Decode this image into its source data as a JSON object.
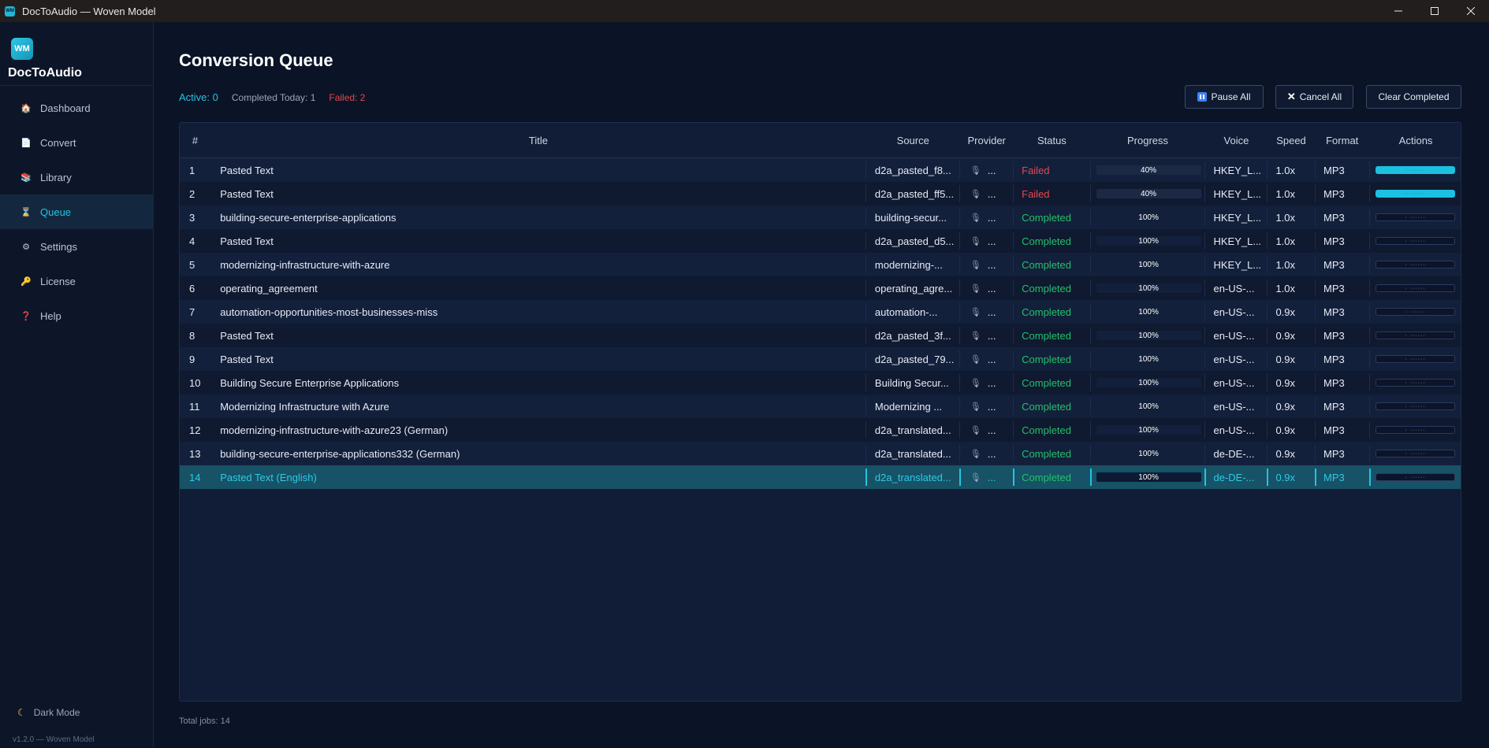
{
  "window": {
    "title": "DocToAudio — Woven Model",
    "icon_text": "WM",
    "controls": [
      "minimize-icon",
      "maximize-icon",
      "close-icon"
    ]
  },
  "sidebar": {
    "logo_text": "WM",
    "app_name": "DocToAudio",
    "items": [
      {
        "label": "Dashboard",
        "icon": "home-icon",
        "glyph": "🏠"
      },
      {
        "label": "Convert",
        "icon": "document-icon",
        "glyph": "📄"
      },
      {
        "label": "Library",
        "icon": "books-icon",
        "glyph": "📚"
      },
      {
        "label": "Queue",
        "icon": "hourglass-icon",
        "glyph": "⌛",
        "active": true
      },
      {
        "label": "Settings",
        "icon": "gear-icon",
        "glyph": "⚙"
      },
      {
        "label": "License",
        "icon": "key-icon",
        "glyph": "🔑"
      },
      {
        "label": "Help",
        "icon": "question-icon",
        "glyph": "❓"
      }
    ],
    "dark_mode_label": "Dark Mode",
    "version": "v1.2.0 — Woven Model"
  },
  "main": {
    "title": "Conversion Queue",
    "stats": {
      "active": "Active: 0",
      "completed_today": "Completed Today: 1",
      "failed": "Failed: 2"
    },
    "buttons": {
      "pause_all": "Pause All",
      "cancel_all": "Cancel All",
      "clear_completed": "Clear Completed"
    },
    "columns": [
      "#",
      "Title",
      "Source",
      "Provider",
      "Status",
      "Progress",
      "Voice",
      "Speed",
      "Format",
      "Actions"
    ],
    "rows": [
      {
        "num": "1",
        "title": "Pasted Text",
        "source": "d2a_pasted_f8...",
        "provider": "...",
        "status": "Failed",
        "progress": 40,
        "progress_label": "40%",
        "voice": "HKEY_L...",
        "speed": "1.0x",
        "format": "MP3",
        "action_active": true
      },
      {
        "num": "2",
        "title": "Pasted Text",
        "source": "d2a_pasted_ff5...",
        "provider": "...",
        "status": "Failed",
        "progress": 40,
        "progress_label": "40%",
        "voice": "HKEY_L...",
        "speed": "1.0x",
        "format": "MP3",
        "action_active": true
      },
      {
        "num": "3",
        "title": "building-secure-enterprise-applications",
        "source": "building-secur...",
        "provider": "...",
        "status": "Completed",
        "progress": 100,
        "progress_label": "100%",
        "voice": "HKEY_L...",
        "speed": "1.0x",
        "format": "MP3",
        "action_active": false
      },
      {
        "num": "4",
        "title": "Pasted Text",
        "source": "d2a_pasted_d5...",
        "provider": "...",
        "status": "Completed",
        "progress": 100,
        "progress_label": "100%",
        "voice": "HKEY_L...",
        "speed": "1.0x",
        "format": "MP3",
        "action_active": false
      },
      {
        "num": "5",
        "title": "modernizing-infrastructure-with-azure",
        "source": "modernizing-...",
        "provider": "...",
        "status": "Completed",
        "progress": 100,
        "progress_label": "100%",
        "voice": "HKEY_L...",
        "speed": "1.0x",
        "format": "MP3",
        "action_active": false
      },
      {
        "num": "6",
        "title": "operating_agreement",
        "source": "operating_agre...",
        "provider": "...",
        "status": "Completed",
        "progress": 100,
        "progress_label": "100%",
        "voice": "en-US-...",
        "speed": "1.0x",
        "format": "MP3",
        "action_active": false
      },
      {
        "num": "7",
        "title": "automation-opportunities-most-businesses-miss",
        "source": "automation-...",
        "provider": "...",
        "status": "Completed",
        "progress": 100,
        "progress_label": "100%",
        "voice": "en-US-...",
        "speed": "0.9x",
        "format": "MP3",
        "action_active": false
      },
      {
        "num": "8",
        "title": "Pasted Text",
        "source": "d2a_pasted_3f...",
        "provider": "...",
        "status": "Completed",
        "progress": 100,
        "progress_label": "100%",
        "voice": "en-US-...",
        "speed": "0.9x",
        "format": "MP3",
        "action_active": false
      },
      {
        "num": "9",
        "title": "Pasted Text",
        "source": "d2a_pasted_79...",
        "provider": "...",
        "status": "Completed",
        "progress": 100,
        "progress_label": "100%",
        "voice": "en-US-...",
        "speed": "0.9x",
        "format": "MP3",
        "action_active": false
      },
      {
        "num": "10",
        "title": "Building Secure Enterprise Applications",
        "source": "Building Secur...",
        "provider": "...",
        "status": "Completed",
        "progress": 100,
        "progress_label": "100%",
        "voice": "en-US-...",
        "speed": "0.9x",
        "format": "MP3",
        "action_active": false
      },
      {
        "num": "11",
        "title": "Modernizing Infrastructure with Azure",
        "source": "Modernizing ...",
        "provider": "...",
        "status": "Completed",
        "progress": 100,
        "progress_label": "100%",
        "voice": "en-US-...",
        "speed": "0.9x",
        "format": "MP3",
        "action_active": false
      },
      {
        "num": "12",
        "title": "modernizing-infrastructure-with-azure23 (German)",
        "source": "d2a_translated...",
        "provider": "...",
        "status": "Completed",
        "progress": 100,
        "progress_label": "100%",
        "voice": "en-US-...",
        "speed": "0.9x",
        "format": "MP3",
        "action_active": false
      },
      {
        "num": "13",
        "title": "building-secure-enterprise-applications332 (German)",
        "source": "d2a_translated...",
        "provider": "...",
        "status": "Completed",
        "progress": 100,
        "progress_label": "100%",
        "voice": "de-DE-...",
        "speed": "0.9x",
        "format": "MP3",
        "action_active": false
      },
      {
        "num": "14",
        "title": "Pasted Text (English)",
        "source": "d2a_translated...",
        "provider": "...",
        "status": "Completed",
        "progress": 100,
        "progress_label": "100%",
        "voice": "de-DE-...",
        "speed": "0.9x",
        "format": "MP3",
        "action_active": false,
        "selected": true
      }
    ],
    "total": "Total jobs: 14"
  },
  "colors": {
    "accent": "#25c3e2",
    "failed": "#e5484d",
    "completed": "#23c06b",
    "background": "#0b1326"
  }
}
